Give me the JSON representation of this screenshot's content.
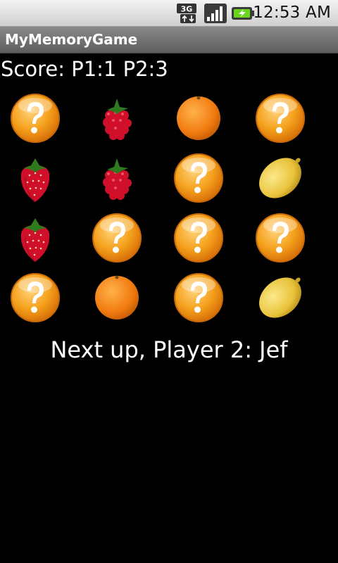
{
  "status_bar": {
    "network_icon": "3g-data-icon",
    "network_label": "3G",
    "signal_icon": "signal-strength-icon",
    "battery_icon": "battery-charging-icon",
    "time": "12:53 AM"
  },
  "app": {
    "title": "MyMemoryGame"
  },
  "game": {
    "score_text": "Score: P1:1 P2:3",
    "next_up_text": "Next up, Player 2: Jef",
    "columns": 4,
    "rows": 4,
    "cards": [
      {
        "face": "hidden"
      },
      {
        "face": "raspberry"
      },
      {
        "face": "orange"
      },
      {
        "face": "hidden"
      },
      {
        "face": "strawberry"
      },
      {
        "face": "raspberry"
      },
      {
        "face": "hidden"
      },
      {
        "face": "lemon"
      },
      {
        "face": "strawberry"
      },
      {
        "face": "hidden"
      },
      {
        "face": "hidden"
      },
      {
        "face": "hidden"
      },
      {
        "face": "hidden"
      },
      {
        "face": "orange"
      },
      {
        "face": "hidden"
      },
      {
        "face": "lemon"
      }
    ]
  },
  "colors": {
    "background": "#000000",
    "hidden_card": "#f5a11c",
    "orange": "#f07a10",
    "lemon": "#e8c23a",
    "berry": "#d0102a",
    "leaf": "#2f7a1e"
  }
}
